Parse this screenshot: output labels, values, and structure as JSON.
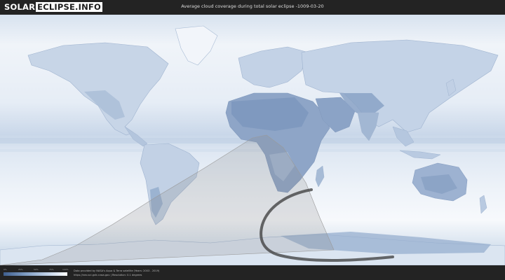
{
  "header": {
    "logo_solar": "SOLAR",
    "logo_rest": "ECLIPSE.INFO",
    "title": "Average cloud coverage during total solar eclipse -1009-03-20"
  },
  "legend": {
    "ticks": [
      "0%",
      "25%",
      "50%",
      "75%",
      "100%"
    ],
    "colors": [
      "#3f5f8f",
      "#7f9cc2",
      "#c3d3e8",
      "#ffffff"
    ]
  },
  "footer": {
    "credit_line1": "Data provided by NASA's Aqua & Terra satellite (Years: 2003 - 2019)",
    "credit_line2": "https://neo.sci.gsfc.nasa.gov | Resolution: 0.1 degrees"
  },
  "map": {
    "projection": "equirectangular",
    "ocean_color": "#e4ecf5",
    "land_color": "#8fa6c6",
    "eclipse_band_color": "#8a8a8a",
    "totality_path_color": "#3a3a3a"
  }
}
